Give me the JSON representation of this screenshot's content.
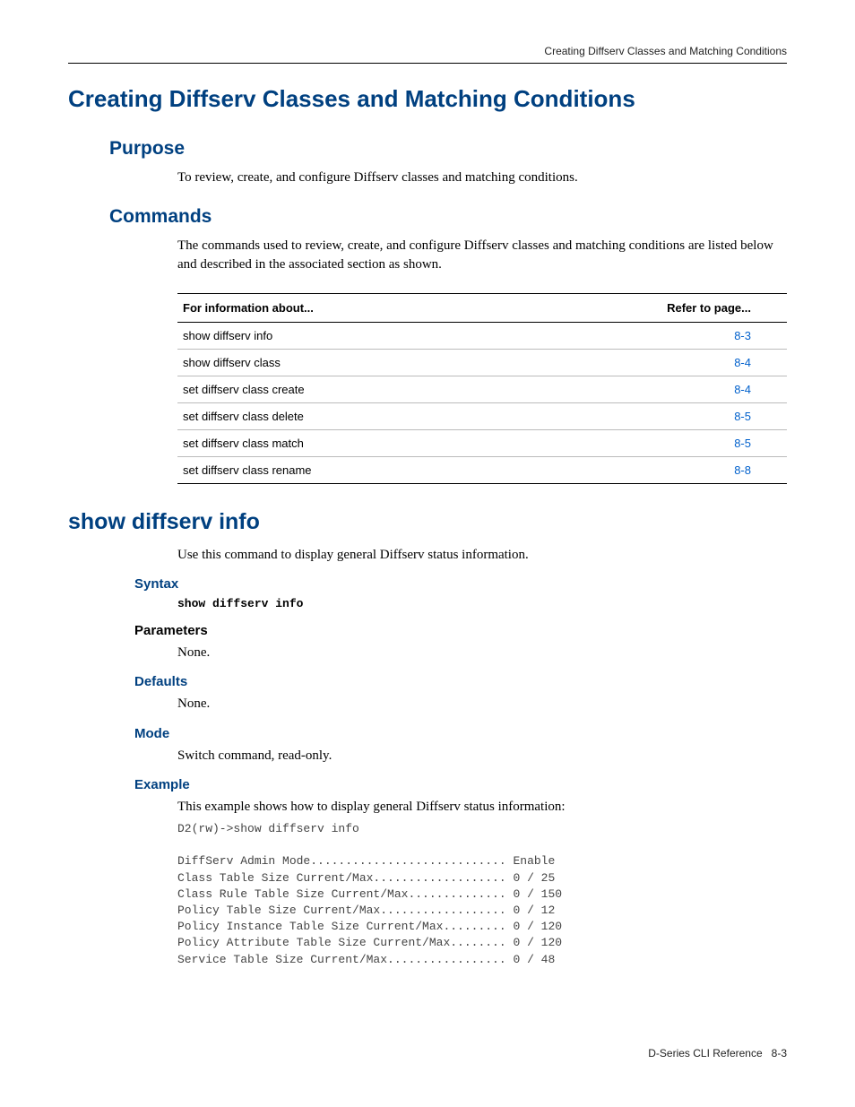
{
  "running_header": "Creating Diffserv Classes and Matching Conditions",
  "h1": "Creating Diffserv Classes and Matching Conditions",
  "purpose": {
    "heading": "Purpose",
    "text": "To review, create, and configure Diffserv classes and matching conditions."
  },
  "commands": {
    "heading": "Commands",
    "intro": "The commands used to review, create, and configure Diffserv classes and matching conditions are listed below and described in the associated section as shown.",
    "col_info": "For information about...",
    "col_page": "Refer to page...",
    "rows": [
      {
        "info": "show diffserv info",
        "page": "8-3"
      },
      {
        "info": "show diffserv class",
        "page": "8-4"
      },
      {
        "info": "set diffserv class create",
        "page": "8-4"
      },
      {
        "info": "set diffserv class delete",
        "page": "8-5"
      },
      {
        "info": "set diffserv class match",
        "page": "8-5"
      },
      {
        "info": "set diffserv class rename",
        "page": "8-8"
      }
    ]
  },
  "show_info": {
    "heading": "show diffserv info",
    "intro": "Use this command to display general Diffserv status information.",
    "syntax_h": "Syntax",
    "syntax_code": "show diffserv info",
    "parameters_h": "Parameters",
    "parameters_v": "None.",
    "defaults_h": "Defaults",
    "defaults_v": "None.",
    "mode_h": "Mode",
    "mode_v": "Switch command, read-only.",
    "example_h": "Example",
    "example_intro": "This example shows how to display general Diffserv status information:",
    "example_code": "D2(rw)->show diffserv info\n\nDiffServ Admin Mode............................ Enable\nClass Table Size Current/Max................... 0 / 25\nClass Rule Table Size Current/Max.............. 0 / 150\nPolicy Table Size Current/Max.................. 0 / 12\nPolicy Instance Table Size Current/Max......... 0 / 120\nPolicy Attribute Table Size Current/Max........ 0 / 120\nService Table Size Current/Max................. 0 / 48"
  },
  "footer": {
    "doc": "D-Series CLI Reference",
    "pagenum": "8-3"
  }
}
